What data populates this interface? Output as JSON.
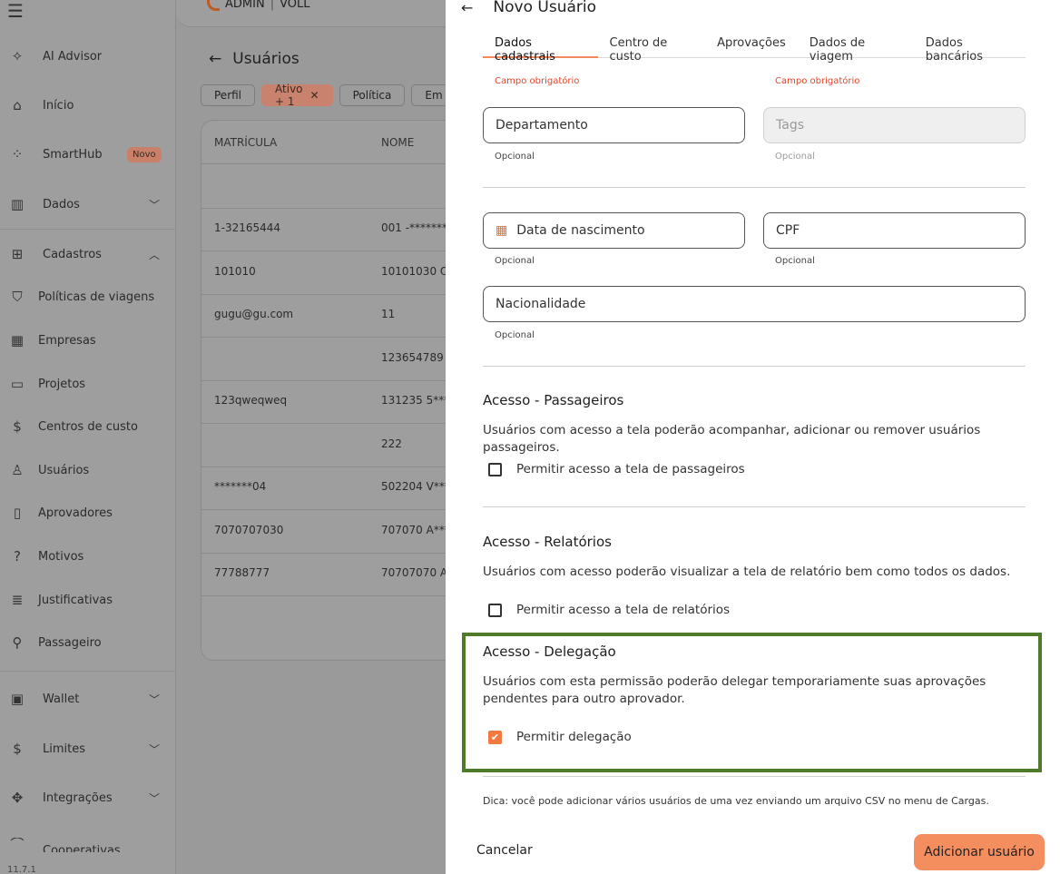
{
  "sidebar": {
    "menu_icon": "hamburger-icon",
    "items": [
      {
        "label": "AI Advisor",
        "icon": "sparkle-icon"
      },
      {
        "label": "Início",
        "icon": "home-icon"
      },
      {
        "label": "SmartHub",
        "icon": "apps-icon",
        "badge": "Novo"
      },
      {
        "label": "Dados",
        "icon": "chart-icon"
      },
      {
        "label": "Cadastros",
        "icon": "folder-plus-icon"
      },
      {
        "label": "Políticas de viagens",
        "icon": "shield-icon"
      },
      {
        "label": "Empresas",
        "icon": "building-icon"
      },
      {
        "label": "Projetos",
        "icon": "folder-icon"
      },
      {
        "label": "Centros de custo",
        "icon": "dollar-icon"
      },
      {
        "label": "Usuários",
        "icon": "user-icon"
      },
      {
        "label": "Aprovadores",
        "icon": "approval-doc-icon"
      },
      {
        "label": "Motivos",
        "icon": "question-icon"
      },
      {
        "label": "Justificativas",
        "icon": "list-icon"
      },
      {
        "label": "Passageiro",
        "icon": "walking-icon"
      },
      {
        "label": "Wallet",
        "icon": "wallet-icon"
      },
      {
        "label": "Limites",
        "icon": "dollar-icon"
      },
      {
        "label": "Integrações",
        "icon": "integration-icon"
      },
      {
        "label": "Cooperativas",
        "icon": "coop-icon"
      }
    ],
    "version": "11.7.1"
  },
  "main": {
    "brand": "ADMIN",
    "brand_sub": "VOLL",
    "title": "Usuários",
    "chips": [
      {
        "label": "Perfil"
      },
      {
        "label": "Ativo + 1"
      },
      {
        "label": "Política"
      },
      {
        "label": "Em"
      }
    ],
    "table": {
      "headers": [
        "MATRÍCULA",
        "NOME"
      ],
      "rows": [
        [
          "",
          ""
        ],
        [
          "1-32165444",
          "001 -*******"
        ],
        [
          "101010",
          "10101030 O*"
        ],
        [
          "gugu@gu.com",
          "11"
        ],
        [
          "",
          "123654789"
        ],
        [
          "123qweqweq",
          "131235 5***"
        ],
        [
          "",
          "222"
        ],
        [
          "*******04",
          "502204 V***"
        ],
        [
          "7070707030",
          "707070 A***"
        ],
        [
          "77788777",
          "70707070 A*"
        ]
      ]
    }
  },
  "drawer": {
    "title": "Novo Usuário",
    "tabs": [
      "Dados cadastrais",
      "Centro de custo",
      "Aprovações",
      "Dados de viagem",
      "Dados bancários"
    ],
    "required_label": "Campo obrigatório",
    "optional_label": "Opcional",
    "fields": {
      "departamento": "Departamento",
      "tags": "Tags",
      "nascimento": "Data de nascimento",
      "cpf": "CPF",
      "nacionalidade": "Nacionalidade"
    },
    "sections": {
      "passageiros": {
        "title": "Acesso - Passageiros",
        "desc": "Usuários com acesso a tela poderão acompanhar, adicionar ou remover usuários passageiros.",
        "checkbox": "Permitir acesso a tela de passageiros",
        "checked": false
      },
      "relatorios": {
        "title": "Acesso - Relatórios",
        "desc": "Usuários com acesso poderão visualizar a tela de relatório bem como todos os dados.",
        "checkbox": "Permitir acesso a tela de relatórios",
        "checked": false
      },
      "delegacao": {
        "title": "Acesso - Delegação",
        "desc": "Usuários com esta permissão poderão delegar temporariamente suas aprovações pendentes para outro aprovador.",
        "checkbox": "Permitir delegação",
        "checked": true
      }
    },
    "tip": "Dica: você pode adicionar vários usuários de uma vez enviando um arquivo CSV no menu de Cargas.",
    "cancel_label": "Cancelar",
    "submit_label": "Adicionar usuário"
  },
  "colors": {
    "accent": "#f58e5f",
    "checkbox": "#f2793f",
    "required": "#e0452b",
    "highlight": "#4e7a2a",
    "overlay": "#9d9d9d"
  }
}
